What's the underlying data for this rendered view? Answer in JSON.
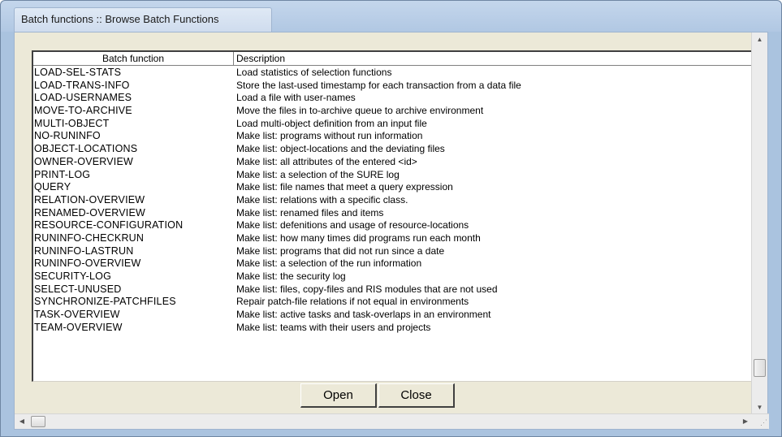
{
  "window": {
    "title": "Batch functions :: Browse Batch Functions"
  },
  "table": {
    "columns": [
      "Batch function",
      "Description"
    ],
    "rows": [
      [
        "LOAD-SEL-STATS",
        "Load statistics of selection functions"
      ],
      [
        "LOAD-TRANS-INFO",
        "Store the last-used timestamp for each transaction from a data file"
      ],
      [
        "LOAD-USERNAMES",
        "Load a file with user-names"
      ],
      [
        "MOVE-TO-ARCHIVE",
        "Move the files in to-archive queue to archive environment"
      ],
      [
        "MULTI-OBJECT",
        "Load multi-object definition from an input file"
      ],
      [
        "NO-RUNINFO",
        "Make list: programs without run information"
      ],
      [
        "OBJECT-LOCATIONS",
        "Make list: object-locations and the deviating files"
      ],
      [
        "OWNER-OVERVIEW",
        "Make list: all attributes of the entered <id>"
      ],
      [
        "PRINT-LOG",
        "Make list: a selection of the SURE log"
      ],
      [
        "QUERY",
        "Make list: file names that meet a query expression"
      ],
      [
        "RELATION-OVERVIEW",
        "Make list: relations with a specific class."
      ],
      [
        "RENAMED-OVERVIEW",
        "Make list: renamed files and items"
      ],
      [
        "RESOURCE-CONFIGURATION",
        "Make list: defenitions and usage of resource-locations"
      ],
      [
        "RUNINFO-CHECKRUN",
        "Make list: how many times did programs run each month"
      ],
      [
        "RUNINFO-LASTRUN",
        "Make list: programs that did not run since a date"
      ],
      [
        "RUNINFO-OVERVIEW",
        "Make list: a selection of the run information"
      ],
      [
        "SECURITY-LOG",
        "Make list: the security log"
      ],
      [
        "SELECT-UNUSED",
        "Make list: files, copy-files and RIS modules that are not used"
      ],
      [
        "SYNCHRONIZE-PATCHFILES",
        "Repair patch-file relations if not equal in environments"
      ],
      [
        "TASK-OVERVIEW",
        "Make list: active tasks and task-overlaps in an environment"
      ],
      [
        "TEAM-OVERVIEW",
        "Make list: teams with their users and projects"
      ]
    ]
  },
  "buttons": {
    "open": "Open",
    "close": "Close"
  },
  "icons": {
    "scroll_up": "▲",
    "scroll_down": "▼",
    "scroll_left": "◀",
    "scroll_right": "▶",
    "resize_grip": "⋰"
  }
}
